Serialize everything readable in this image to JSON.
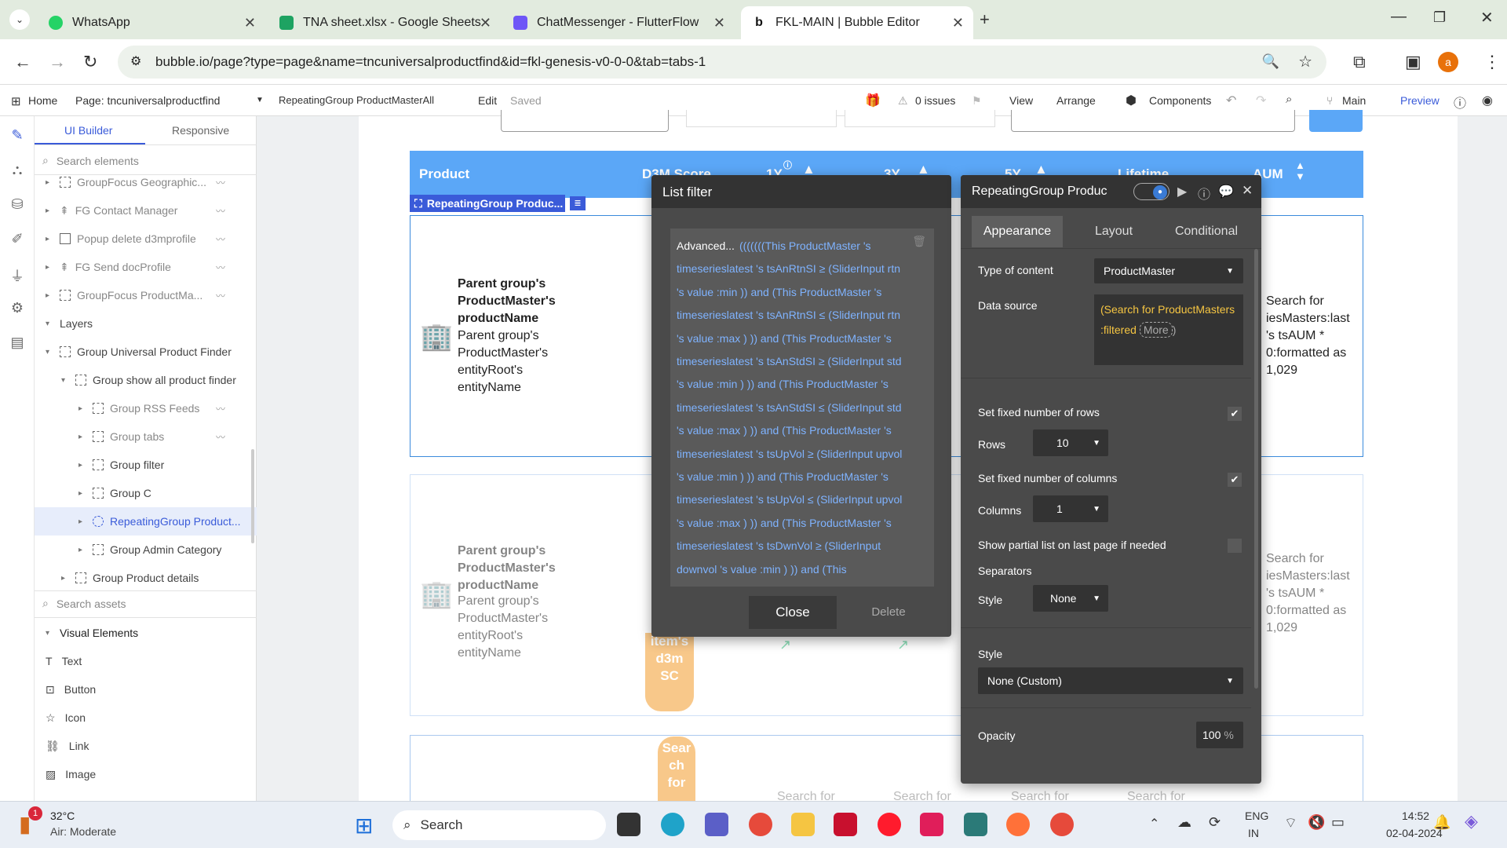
{
  "browser": {
    "tabs": [
      {
        "label": "WhatsApp",
        "color": "#25d366"
      },
      {
        "label": "TNA sheet.xlsx - Google Sheets",
        "color": "#1ea362"
      },
      {
        "label": "ChatMessenger - FlutterFlow",
        "color": "#6e56f7"
      },
      {
        "label": "FKL-MAIN | Bubble Editor",
        "color": "#111111"
      }
    ],
    "url": "bubble.io/page?type=page&name=tncuniversalproductfind&id=fkl-genesis-v0-0-0&tab=tabs-1",
    "profile_initial": "a"
  },
  "bubble_top": {
    "home": "Home",
    "page": "Page: tncuniversalproductfind",
    "element": "RepeatingGroup ProductMasterAll",
    "edit": "Edit",
    "saved": "Saved",
    "issues": "0 issues",
    "view": "View",
    "arrange": "Arrange",
    "components": "Components",
    "branch": "Main",
    "preview": "Preview"
  },
  "sidebar": {
    "tab_ui": "UI Builder",
    "tab_responsive": "Responsive",
    "search_placeholder": "Search elements",
    "items": [
      "GroupFocus Geographic...",
      "FG Contact Manager",
      "Popup delete d3mprofile",
      "FG Send docProfile",
      "GroupFocus ProductMa...",
      "Layers",
      "Group Universal Product Finder",
      "Group show all product finder",
      "Group RSS Feeds",
      "Group tabs",
      "Group filter",
      "Group C",
      "RepeatingGroup Product...",
      "Group Admin Category",
      "Group Product details"
    ],
    "assets_placeholder": "Search assets",
    "visual_title": "Visual Elements",
    "visual_items": [
      "Text",
      "Button",
      "Icon",
      "Link",
      "Image"
    ]
  },
  "canvas": {
    "headers": [
      "Product",
      "D3M Score",
      "1Y",
      "3Y",
      "5Y",
      "Lifetime",
      "AUM"
    ],
    "rg_label": "RepeatingGroup Produc...",
    "row_title": "Parent group's ProductMaster's productName",
    "row_sub": "Parent group's ProductMaster's entityRoot's entityName",
    "aum_text": "Search for\niesMasters:last\n's tsAUM *\n0:formatted as\n1,029",
    "aum_text2": "Search for\niesMasters:last\n's tsAUM *\n0:formatted as\n1,029",
    "pill_text": "item's\nd3m\nSC",
    "pill_text2": "Sear\nch\nfor",
    "search_for": "Search for"
  },
  "list_filter": {
    "title": "List filter",
    "advanced": "Advanced...",
    "expression": "(((((((This ProductMaster 's timeserieslatest 's tsAnRtnSI ≥ (SliderInput rtn 's value :min )) and (This ProductMaster 's timeserieslatest 's tsAnRtnSI ≤ (SliderInput rtn 's value :max ) )) and (This ProductMaster 's timeserieslatest 's tsAnStdSI ≥ (SliderInput std 's value :min ) )) and (This ProductMaster 's timeserieslatest 's tsAnStdSI ≤ (SliderInput std 's value :max ) )) and (This ProductMaster 's timeserieslatest 's tsUpVol ≥ (SliderInput upvol 's value :min ) )) and (This ProductMaster 's timeserieslatest 's tsUpVol ≤ (SliderInput upvol 's value :max ) )) and (This ProductMaster 's timeserieslatest 's tsDwnVol ≥ (SliderInput downvol 's value :min ) )) and (This ProductMaster 's timeserieslatest 's tsDwnVol ≤ (SliderInput",
    "close": "Close",
    "delete": "Delete"
  },
  "props": {
    "title": "RepeatingGroup Produc",
    "tabs": [
      "Appearance",
      "Layout",
      "Conditional"
    ],
    "type_label": "Type of content",
    "type_value": "ProductMaster",
    "source_label": "Data source",
    "source_value": "(Search for ProductMasters :filtered",
    "source_more": "More",
    "fixed_rows_label": "Set fixed number of rows",
    "rows_label": "Rows",
    "rows_value": "10",
    "fixed_cols_label": "Set fixed number of columns",
    "cols_label": "Columns",
    "cols_value": "1",
    "partial_label": "Show partial list on last page if needed",
    "separators_label": "Separators",
    "sep_style_label": "Style",
    "sep_style_value": "None",
    "style_label": "Style",
    "style_value": "None (Custom)",
    "opacity_label": "Opacity",
    "opacity_value": "100",
    "opacity_unit": "%"
  },
  "taskbar": {
    "temp": "32°C",
    "weather": "Air: Moderate",
    "badge": "1",
    "search": "Search",
    "lang1": "ENG",
    "lang2": "IN",
    "time": "14:52",
    "date": "02-04-2024"
  }
}
